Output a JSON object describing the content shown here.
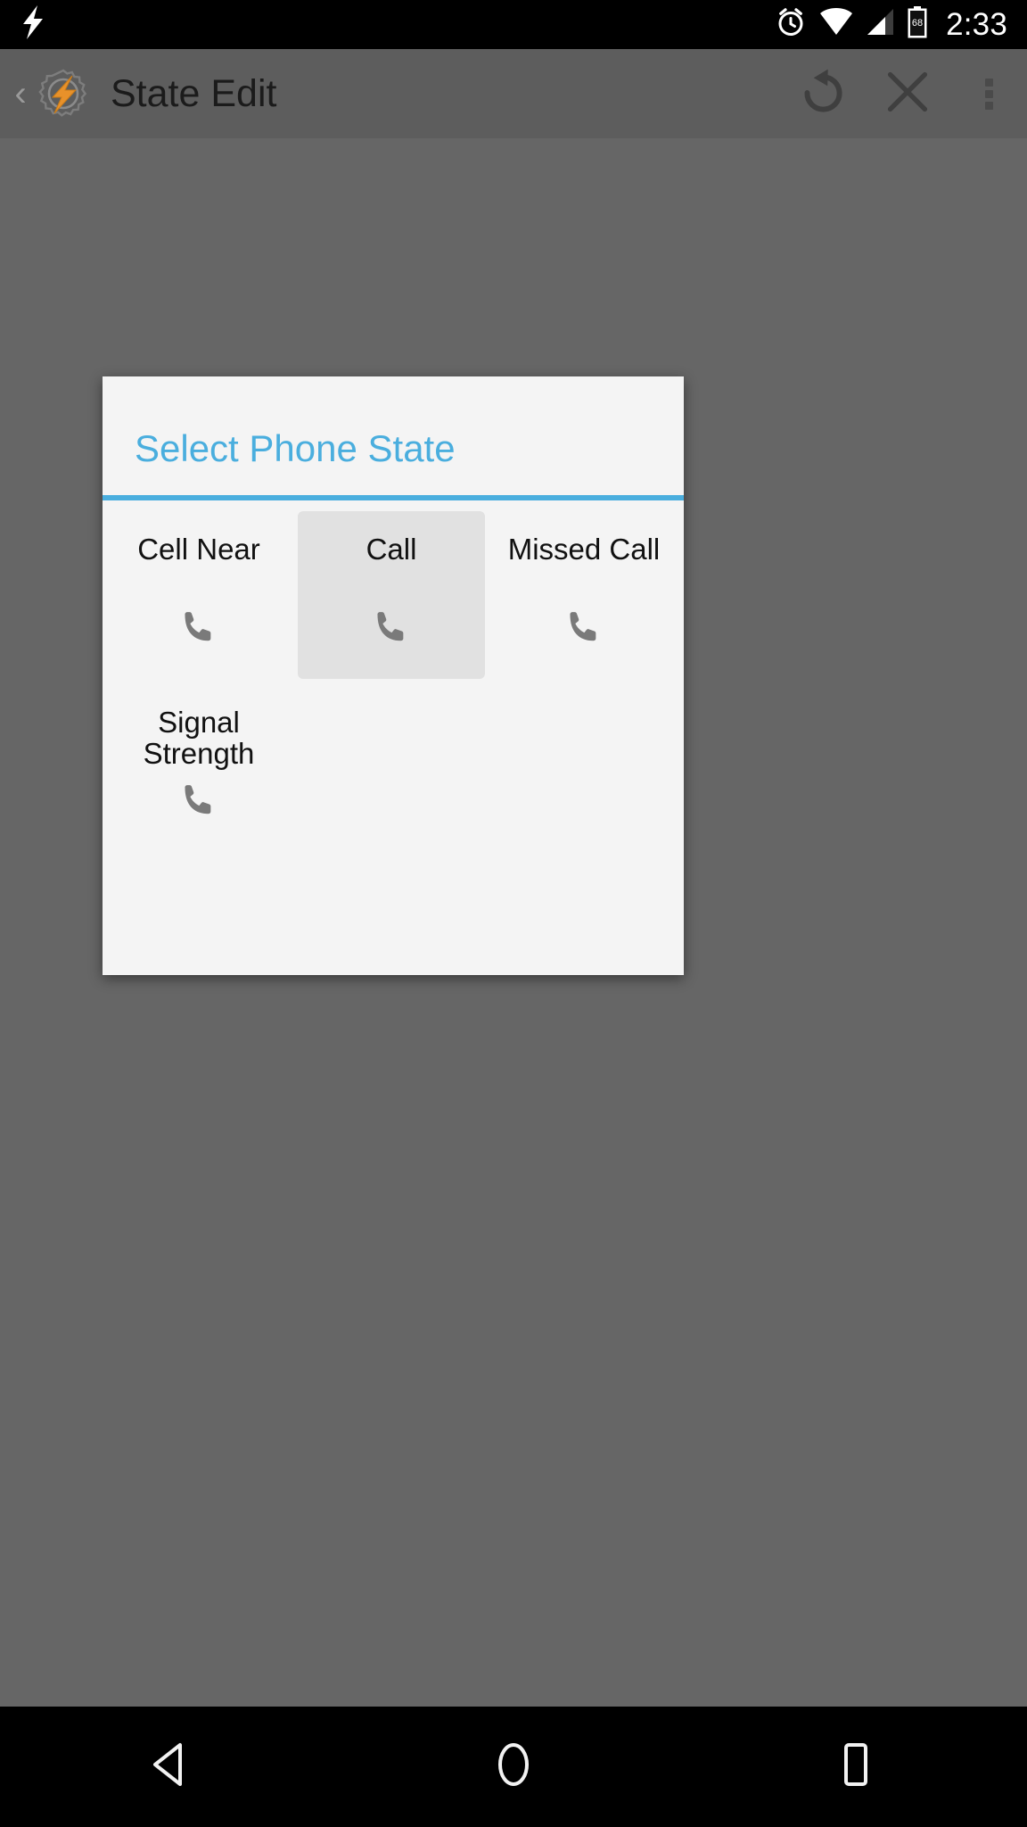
{
  "status_bar": {
    "left_icon": "flash-bolt-icon",
    "icons": [
      "alarm-icon",
      "wifi-icon",
      "cell-signal-icon",
      "battery-icon"
    ],
    "battery_level": "68",
    "time": "2:33",
    "background": "#000000"
  },
  "action_bar": {
    "up_chevron": "‹",
    "app_icon": "tasker-gear-bolt-icon",
    "title": "State Edit",
    "background": "#5d5d5d",
    "actions": [
      {
        "name": "revert-button",
        "icon": "undo-circular-arrow-icon"
      },
      {
        "name": "cancel-button",
        "icon": "close-x-icon"
      },
      {
        "name": "overflow-menu-button",
        "icon": "overflow-dots-icon"
      }
    ]
  },
  "dialog": {
    "title": "Select Phone State",
    "accent_color": "#4aaede",
    "background": "#f4f4f4",
    "items": [
      {
        "label": "Cell Near",
        "icon": "phone-handset-icon",
        "selected": false
      },
      {
        "label": "Call",
        "icon": "phone-handset-icon",
        "selected": true
      },
      {
        "label": "Missed Call",
        "icon": "phone-handset-icon",
        "selected": false
      },
      {
        "label": "Signal Strength",
        "icon": "phone-handset-icon",
        "selected": false
      }
    ]
  },
  "nav_bar": {
    "background": "#000000",
    "buttons": [
      {
        "name": "nav-back-button",
        "icon": "triangle-back-icon"
      },
      {
        "name": "nav-home-button",
        "icon": "circle-home-icon"
      },
      {
        "name": "nav-recents-button",
        "icon": "square-recents-icon"
      }
    ]
  }
}
